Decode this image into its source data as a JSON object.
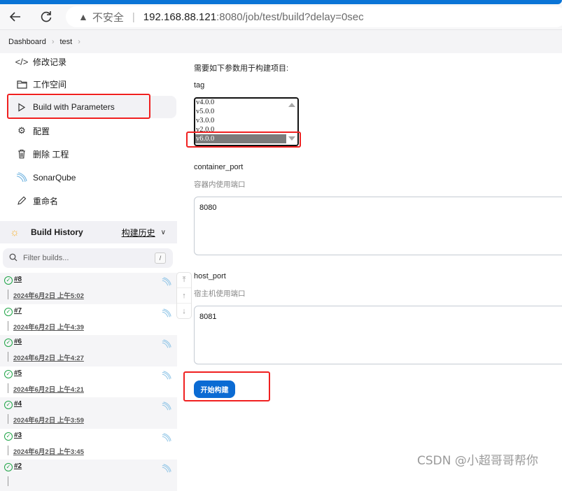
{
  "browser": {
    "security_label": "不安全",
    "url_host": "192.168.88.121",
    "url_rest": ":8080/job/test/build?delay=0sec"
  },
  "breadcrumb": [
    "Dashboard",
    "test"
  ],
  "sidebar": {
    "tasks": [
      {
        "icon": "code-icon",
        "label": "修改记录"
      },
      {
        "icon": "folder-icon",
        "label": "工作空间"
      },
      {
        "icon": "play-icon",
        "label": "Build with Parameters",
        "active": true
      },
      {
        "icon": "gear-icon",
        "label": "配置"
      },
      {
        "icon": "trash-icon",
        "label": "删除 工程"
      },
      {
        "icon": "sonarqube-icon",
        "label": "SonarQube"
      },
      {
        "icon": "pencil-icon",
        "label": "重命名"
      }
    ],
    "build_history": {
      "title": "Build History",
      "trend_label": "构建历史",
      "filter_placeholder": "Filter builds...",
      "filter_shortcut": "/",
      "builds": [
        {
          "number": "#8",
          "time": "2024年6月2日 上午5:02",
          "status": "success"
        },
        {
          "number": "#7",
          "time": "2024年6月2日 上午4:39",
          "status": "success"
        },
        {
          "number": "#6",
          "time": "2024年6月2日 上午4:27",
          "status": "success"
        },
        {
          "number": "#5",
          "time": "2024年6月2日 上午4:21",
          "status": "success"
        },
        {
          "number": "#4",
          "time": "2024年6月2日 上午3:59",
          "status": "success"
        },
        {
          "number": "#3",
          "time": "2024年6月2日 上午3:45",
          "status": "success"
        },
        {
          "number": "#2",
          "time": "",
          "status": "success"
        }
      ]
    }
  },
  "main": {
    "description": "需要如下参数用于构建项目:",
    "params": {
      "tag": {
        "label": "tag",
        "options": [
          "v4.0.0",
          "v5.0.0",
          "v3.0.0",
          "v2.0.0",
          "v6.0.0"
        ],
        "selected": "v6.0.0"
      },
      "container_port": {
        "label": "container_port",
        "hint": "容器内使用端口",
        "value": "8080"
      },
      "host_port": {
        "label": "host_port",
        "hint": "宿主机使用端口",
        "value": "8081"
      }
    },
    "build_button": "开始构建"
  },
  "watermark": "CSDN @小超哥哥帮你",
  "colors": {
    "accent": "#0b6bd3",
    "highlight_box": "#f02020",
    "success": "#1ea446"
  }
}
